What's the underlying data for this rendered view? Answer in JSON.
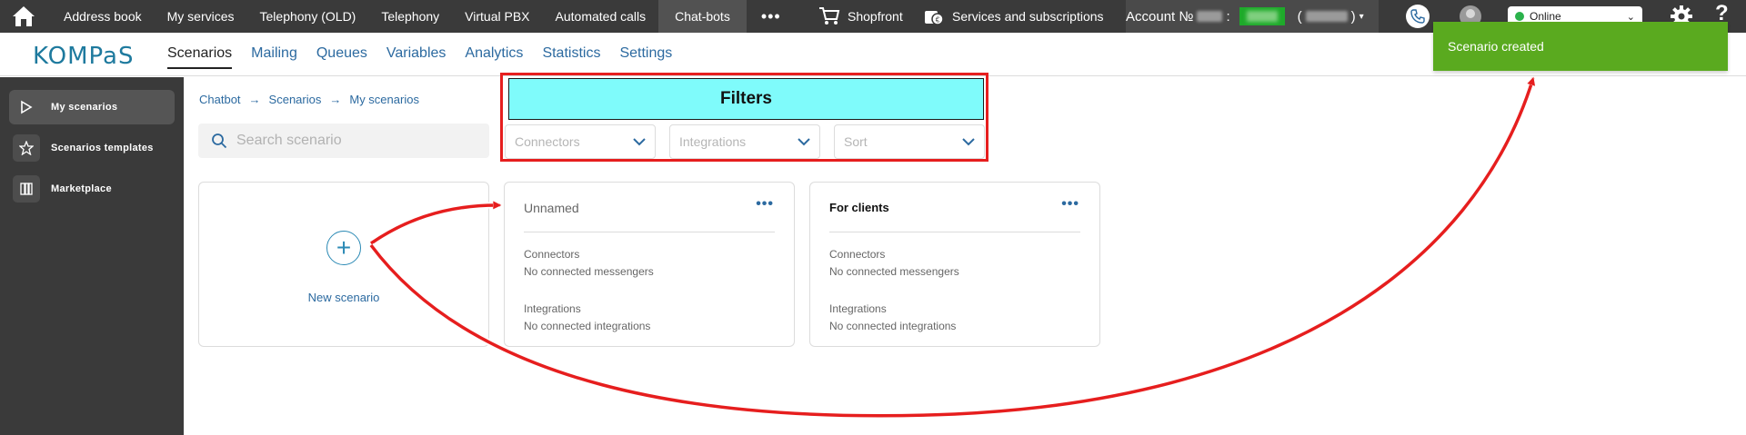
{
  "topbar": {
    "nav": [
      "Address book",
      "My services",
      "Telephony (OLD)",
      "Telephony",
      "Virtual PBX",
      "Automated calls",
      "Chat-bots"
    ],
    "more": "•••",
    "shopfront": "Shopfront",
    "services": "Services and subscriptions",
    "account_label": "Account №",
    "account_colon": ":",
    "account_paren_open": "(",
    "account_paren_close": ")",
    "status": "Online",
    "help": "?"
  },
  "subbar": {
    "logo": "KOMPaS",
    "tabs": [
      "Scenarios",
      "Mailing",
      "Queues",
      "Variables",
      "Analytics",
      "Statistics",
      "Settings"
    ]
  },
  "sidebar": {
    "items": [
      "My scenarios",
      "Scenarios templates",
      "Marketplace"
    ]
  },
  "breadcrumb": [
    "Chatbot",
    "Scenarios",
    "My scenarios"
  ],
  "search": {
    "placeholder": "Search scenario"
  },
  "filters": {
    "title": "Filters",
    "dropdowns": [
      "Connectors",
      "Integrations",
      "Sort"
    ]
  },
  "new_scenario": {
    "label": "New scenario"
  },
  "cards": [
    {
      "title": "Unnamed",
      "connectors_label": "Connectors",
      "connectors_value": "No connected messengers",
      "integrations_label": "Integrations",
      "integrations_value": "No connected integrations",
      "more": "•••"
    },
    {
      "title": "For clients",
      "connectors_label": "Connectors",
      "connectors_value": "No connected messengers",
      "integrations_label": "Integrations",
      "integrations_value": "No connected integrations",
      "more": "•••"
    }
  ],
  "toast": "Scenario created",
  "colors": {
    "topbar": "#3a3a3a",
    "accent_link": "#2c6aa0",
    "toast_green": "#5aaa1f",
    "annotation_red": "#e61e1e",
    "filters_highlight": "#7ffbfb"
  },
  "icons": [
    "home-icon",
    "cart-icon",
    "services-icon",
    "phone-icon",
    "avatar-icon",
    "gear-icon",
    "play-icon",
    "star-icon",
    "marketplace-icon",
    "search-icon",
    "chevron-down-icon",
    "plus-icon",
    "arrow-right-icon"
  ]
}
